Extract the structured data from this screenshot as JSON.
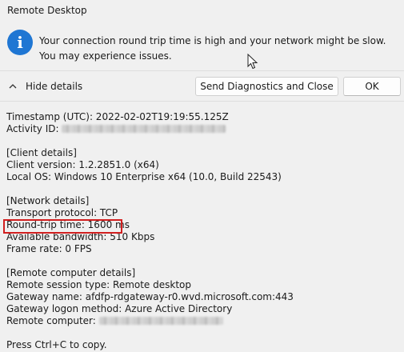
{
  "window": {
    "title": "Remote Desktop"
  },
  "message": {
    "icon": "info-icon",
    "text": "Your connection round trip time is high and your network might be slow. You may experience issues."
  },
  "actions": {
    "toggle_label": "Hide details",
    "diagnostics_label": "Send Diagnostics and Close",
    "ok_label": "OK"
  },
  "details": {
    "timestamp": "Timestamp (UTC): 2022-02-02T19:19:55.125Z",
    "activity_label": "Activity ID: ",
    "client_header": "[Client details]",
    "client_version": "Client version: 1.2.2851.0 (x64)",
    "local_os": "Local OS: Windows 10 Enterprise x64 (10.0, Build 22543)",
    "network_header": "[Network details]",
    "transport": "Transport protocol: TCP",
    "round_trip": "Round-trip time: 1600 ms",
    "bandwidth": "Available bandwidth: 510 Kbps",
    "frame_rate": "Frame rate: 0 FPS",
    "remote_header": "[Remote computer details]",
    "session_type": "Remote session type: Remote desktop",
    "gateway_name": "Gateway name: afdfp-rdgateway-r0.wvd.microsoft.com:443",
    "gateway_logon": "Gateway logon method: Azure Active Directory",
    "remote_label": "Remote computer: ",
    "copy_hint": "Press Ctrl+C to copy."
  },
  "colors": {
    "info_blue": "#1f76d3",
    "highlight_red": "#d11f1f"
  }
}
